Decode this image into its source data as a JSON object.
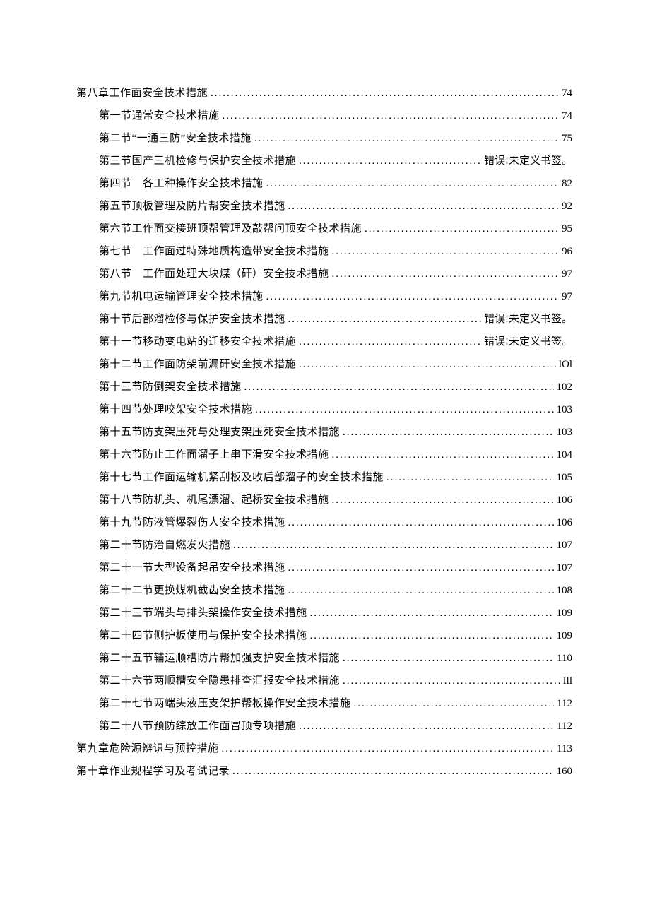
{
  "toc": [
    {
      "level": 1,
      "label": "第八章工作面安全技术措施",
      "page": "74",
      "err": false
    },
    {
      "level": 2,
      "label": "第一节通常安全技术措施",
      "page": "74",
      "err": false
    },
    {
      "level": 2,
      "label": "第二节“一通三防”安全技术措施",
      "page": "75",
      "err": false
    },
    {
      "level": 2,
      "label": "第三节国产三机检修与保护安全技术措施",
      "page": "错误!未定义书签。",
      "err": true
    },
    {
      "level": 2,
      "label": "第四节　各工种操作安全技术措施",
      "page": "82",
      "err": false
    },
    {
      "level": 2,
      "label": "第五节顶板管理及防片帮安全技术措施",
      "page": "92",
      "err": false
    },
    {
      "level": 2,
      "label": "第六节工作面交接班顶帮管理及敲帮问顶安全技术措施",
      "page": "95",
      "err": false
    },
    {
      "level": 2,
      "label": "第七节　工作面过特殊地质构造带安全技术措施",
      "page": "96",
      "err": false
    },
    {
      "level": 2,
      "label": "第八节　工作面处理大块煤（矸）安全技术措施",
      "page": "97",
      "err": false
    },
    {
      "level": 2,
      "label": "第九节机电运输管理安全技术措施",
      "page": "97",
      "err": false
    },
    {
      "level": 2,
      "label": "第十节后部溜检修与保护安全技术措施",
      "page": "错误!未定义书签。",
      "err": true
    },
    {
      "level": 2,
      "label": "第十一节移动变电站的迁移安全技术措施",
      "page": "错误!未定义书签。",
      "err": true
    },
    {
      "level": 2,
      "label": "第十二节工作面防架前漏矸安全技术措施",
      "page": "lOl",
      "err": false
    },
    {
      "level": 2,
      "label": "第十三节防倒架安全技术措施",
      "page": "102",
      "err": false
    },
    {
      "level": 2,
      "label": "第十四节处理咬架安全技术措施",
      "page": "103",
      "err": false
    },
    {
      "level": 2,
      "label": "第十五节防支架压死与处理支架压死安全技术措施",
      "page": "103",
      "err": false
    },
    {
      "level": 2,
      "label": "第十六节防止工作面溜子上串下滑安全技术措施",
      "page": "104",
      "err": false
    },
    {
      "level": 2,
      "label": "第十七节工作面运输机紧刮板及收后部溜子的安全技术措施",
      "page": "105",
      "err": false
    },
    {
      "level": 2,
      "label": "第十八节防机头、机尾漂溜、起桥安全技术措施",
      "page": "106",
      "err": false
    },
    {
      "level": 2,
      "label": "第十九节防液管爆裂伤人安全技术措施",
      "page": "106",
      "err": false
    },
    {
      "level": 2,
      "label": "第二十节防治自燃发火措施",
      "page": "107",
      "err": false
    },
    {
      "level": 2,
      "label": "第二十一节大型设备起吊安全技术措施",
      "page": "107",
      "err": false
    },
    {
      "level": 2,
      "label": "第二十二节更换煤机截齿安全技术措施",
      "page": "108",
      "err": false
    },
    {
      "level": 2,
      "label": "第二十三节端头与排头架操作安全技术措施",
      "page": "109",
      "err": false
    },
    {
      "level": 2,
      "label": "第二十四节侧护板使用与保护安全技术措施",
      "page": "109",
      "err": false
    },
    {
      "level": 2,
      "label": "第二十五节辅运顺槽防片帮加强支护安全技术措施",
      "page": "110",
      "err": false
    },
    {
      "level": 2,
      "label": "第二十六节两顺槽安全隐患排查汇报安全技术措施",
      "page": "Ill",
      "err": false
    },
    {
      "level": 2,
      "label": "第二十七节两端头液压支架护帮板操作安全技术措施",
      "page": "112",
      "err": false
    },
    {
      "level": 2,
      "label": "第二十八节预防综放工作面冒顶专项措施",
      "page": "112",
      "err": false
    },
    {
      "level": 1,
      "label": "第九章危险源辨识与预控措施",
      "page": "113",
      "err": false
    },
    {
      "level": 1,
      "label": "第十章作业规程学习及考试记录",
      "page": "160",
      "err": false
    }
  ]
}
